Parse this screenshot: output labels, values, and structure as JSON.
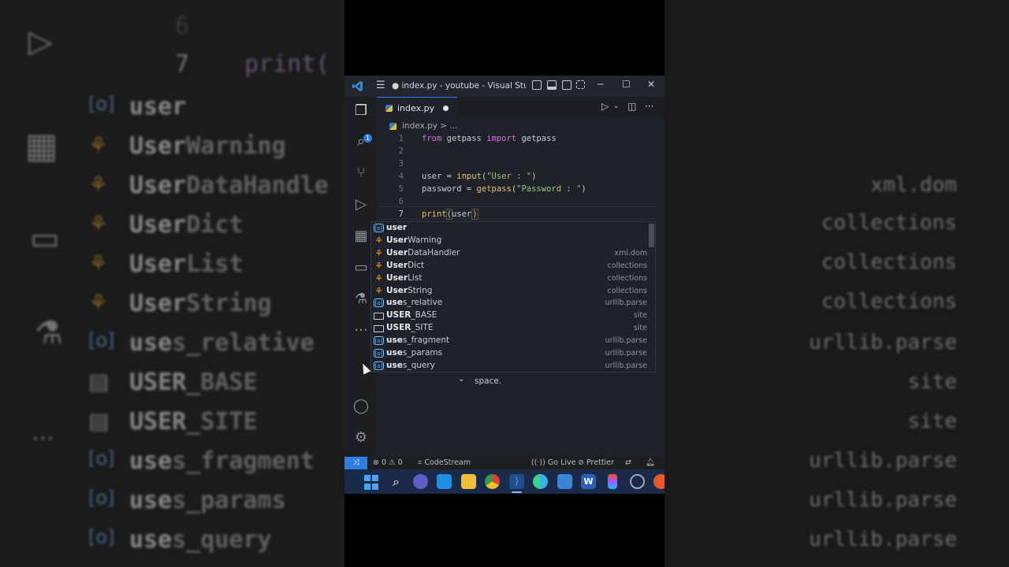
{
  "window": {
    "title": "● index.py - youtube - Visual Studio ...",
    "accent": "#2f7de1"
  },
  "editor": {
    "tab": {
      "label": "index.py",
      "icon": "python-file-icon",
      "dirty": true
    },
    "breadcrumb": "index.py > ...",
    "lines": [
      {
        "num": "1",
        "text": "from getpass import getpass"
      },
      {
        "num": "2",
        "text": ""
      },
      {
        "num": "3",
        "text": ""
      },
      {
        "num": "4",
        "text": "user = input(\"User : \")"
      },
      {
        "num": "5",
        "text": "password = getpass(\"Password : \")"
      },
      {
        "num": "6",
        "text": ""
      },
      {
        "num": "7",
        "text": "print(user)"
      }
    ],
    "code": {
      "l1_kw1": "from",
      "l1_mod": " getpass ",
      "l1_kw2": "import",
      "l1_name": " getpass",
      "l4_a": "user = ",
      "l4_fn": "input",
      "l4_str": "\"User : \"",
      "l5_a": "password = ",
      "l5_fn": "getpass",
      "l5_str": "\"Password : \"",
      "l7_fn": "print",
      "l7_arg": "user",
      "paren_open": "(",
      "paren_close": ")"
    }
  },
  "suggestions": [
    {
      "kind": "variable",
      "match": "user",
      "rest": "",
      "detail": ""
    },
    {
      "kind": "class",
      "match": "User",
      "rest": "Warning",
      "detail": ""
    },
    {
      "kind": "class",
      "match": "User",
      "rest": "DataHandler",
      "detail": "xml.dom"
    },
    {
      "kind": "class",
      "match": "User",
      "rest": "Dict",
      "detail": "collections"
    },
    {
      "kind": "class",
      "match": "User",
      "rest": "List",
      "detail": "collections"
    },
    {
      "kind": "class",
      "match": "User",
      "rest": "String",
      "detail": "collections"
    },
    {
      "kind": "variable",
      "match": "use",
      "rest": "s_relative",
      "detail": "urllib.parse"
    },
    {
      "kind": "module",
      "match": "USER",
      "rest": "_BASE",
      "detail": "site"
    },
    {
      "kind": "module",
      "match": "USER",
      "rest": "_SITE",
      "detail": "site"
    },
    {
      "kind": "variable",
      "match": "use",
      "rest": "s_fragment",
      "detail": "urllib.parse"
    },
    {
      "kind": "variable",
      "match": "use",
      "rest": "s_params",
      "detail": "urllib.parse"
    },
    {
      "kind": "variable",
      "match": "use",
      "rest": "s_query",
      "detail": "urllib.parse"
    }
  ],
  "doc": {
    "text": "space."
  },
  "statusbar": {
    "errors": "0",
    "warnings": "0",
    "codestream": "CodeStream",
    "golive": "Go Live",
    "prettier": "Prettier"
  },
  "background": {
    "dim_numbers": [
      "6",
      "7"
    ],
    "code_echo": "print(",
    "left_items": [
      {
        "kind": "variable",
        "match": "user",
        "rest": ""
      },
      {
        "kind": "class",
        "match": "User",
        "rest": "Warning"
      },
      {
        "kind": "class",
        "match": "User",
        "rest": "DataHandle"
      },
      {
        "kind": "class",
        "match": "User",
        "rest": "Dict"
      },
      {
        "kind": "class",
        "match": "User",
        "rest": "List"
      },
      {
        "kind": "class",
        "match": "User",
        "rest": "String"
      },
      {
        "kind": "variable",
        "match": "use",
        "rest": "s_relative"
      },
      {
        "kind": "module",
        "match": "USER",
        "rest": "_BASE"
      },
      {
        "kind": "module",
        "match": "USER",
        "rest": "_SITE"
      },
      {
        "kind": "variable",
        "match": "use",
        "rest": "s_fragment"
      },
      {
        "kind": "variable",
        "match": "use",
        "rest": "s_params"
      },
      {
        "kind": "variable",
        "match": "use",
        "rest": "s_query"
      }
    ],
    "right_details": [
      "xml.dom",
      "collections",
      "collections",
      "collections",
      "urllib.parse",
      "site",
      "site",
      "urllib.parse",
      "urllib.parse",
      "urllib.parse"
    ]
  }
}
